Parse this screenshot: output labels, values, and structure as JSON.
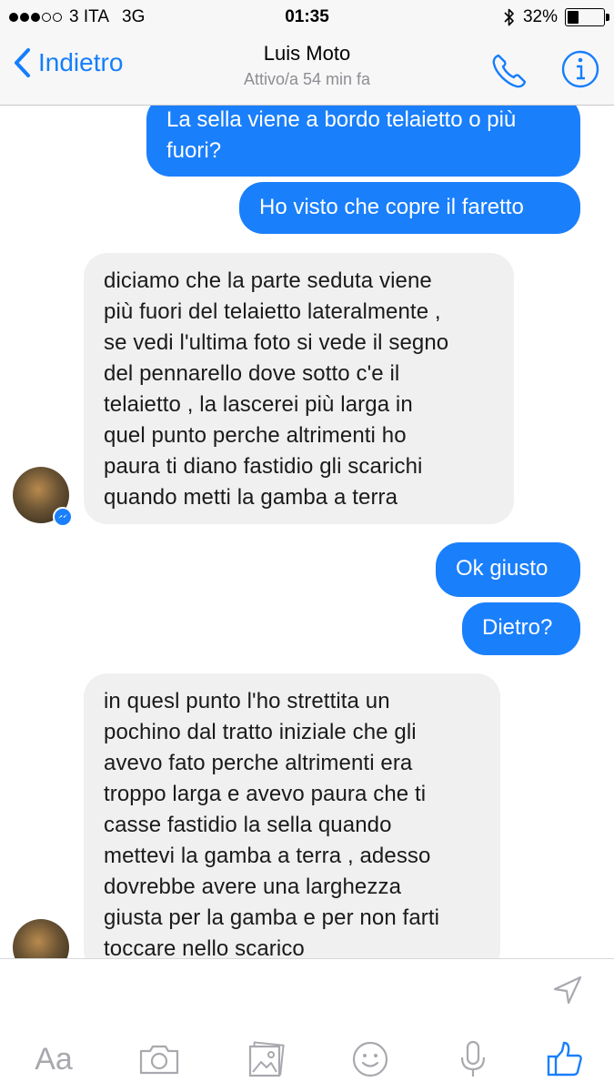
{
  "status_bar": {
    "carrier": "3 ITA",
    "network": "3G",
    "time": "01:35",
    "battery": "32%",
    "battery_level": 0.32,
    "signal_bars": 3
  },
  "header": {
    "back_label": "Indietro",
    "contact_name": "Luis Moto",
    "status": "Attivo/a 54 min fa"
  },
  "messages": [
    {
      "direction": "out",
      "lines": [
        "La sella viene a bordo telaietto o più",
        "fuori?"
      ]
    },
    {
      "direction": "out",
      "lines": [
        "Ho visto che copre il faretto"
      ]
    },
    {
      "direction": "in",
      "lines": [
        "diciamo che la parte seduta viene",
        "più fuori del telaietto lateralmente ,",
        "se vedi l'ultima foto si vede il segno",
        "del pennarello dove sotto c'e il",
        "telaietto , la lascerei più larga in",
        "quel punto perche altrimenti ho",
        "paura ti diano fastidio gli scarichi",
        "quando metti la gamba a terra"
      ]
    },
    {
      "direction": "out",
      "lines": [
        "Ok giusto"
      ]
    },
    {
      "direction": "out",
      "lines": [
        "Dietro?"
      ]
    },
    {
      "direction": "in",
      "lines": [
        "in quesl punto l'ho strettita un",
        "pochino dal tratto iniziale che gli",
        "avevo fato perche altrimenti era",
        "troppo larga e avevo paura che ti",
        "casse fastidio la sella quando",
        "mettevi la gamba a terra , adesso",
        "dovrebbe avere una larghezza",
        "giusta per la gamba e per non farti",
        "toccare nello scarico"
      ]
    }
  ],
  "composer": {
    "text_label": "Aa",
    "icons": [
      "camera-icon",
      "photo-icon",
      "emoji-icon",
      "microphone-icon",
      "like-icon"
    ]
  },
  "colors": {
    "accent": "#1a7ffb",
    "incoming_bubble": "#f0f0f0",
    "header_bg": "#f7f7f8",
    "icon_gray": "#a8a8ae"
  }
}
